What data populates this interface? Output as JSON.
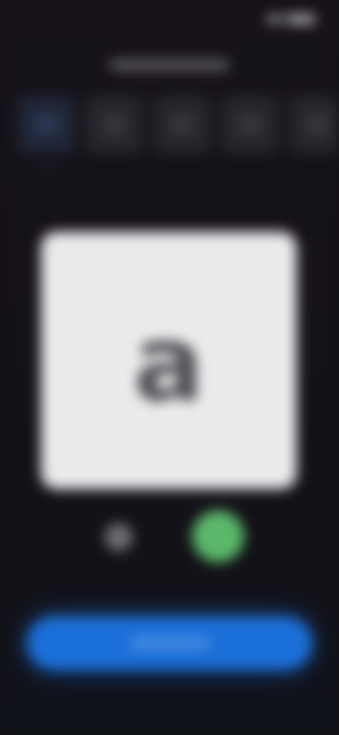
{
  "status_bar": {
    "time": "",
    "battery_icon": "battery-icon",
    "signal_icon": "signal-icon"
  },
  "header": {
    "title": ""
  },
  "thumbnails": {
    "count_visible": 5,
    "selected_index": 0
  },
  "preview": {
    "glyph": "a",
    "background_color": "#ebeaec",
    "glyph_color": "#505054"
  },
  "controls": {
    "left_icon": "dot-icon",
    "right_icon": "green-circle-icon",
    "accent_green": "#5bb86a"
  },
  "primary_button": {
    "label": "",
    "color": "#1b6fd8"
  }
}
